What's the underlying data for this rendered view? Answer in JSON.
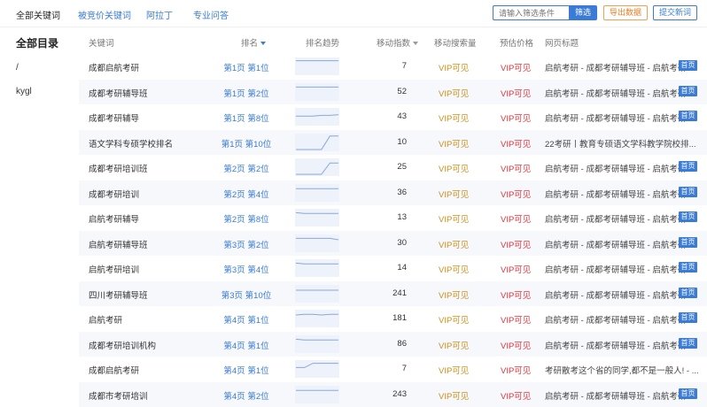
{
  "tabs": [
    "全部关键词",
    "被竞价关键词",
    "阿拉丁",
    "专业问答"
  ],
  "search": {
    "placeholder": "请输入筛选条件"
  },
  "buttons": {
    "filter": "筛选",
    "export": "导出数据",
    "submit": "提交新词"
  },
  "sidebar": {
    "title": "全部目录",
    "items": [
      "/",
      "kygl"
    ]
  },
  "columns": {
    "keyword": "关键词",
    "rank": "排名",
    "trend": "排名趋势",
    "index": "移动指数",
    "volume": "移动搜索量",
    "price": "预估价格",
    "page_title": "网页标题"
  },
  "badge_label": "首页",
  "rows": [
    {
      "keyword": "成都启航考研",
      "rank": "第1页 第1位",
      "trend": [
        2,
        2,
        2,
        2,
        2,
        2
      ],
      "index": "7",
      "volume": "VIP可见",
      "price": "VIP可见",
      "title": "启航考研 - 成都考研辅导班 - 启航考研",
      "badge": true
    },
    {
      "keyword": "成都考研辅导班",
      "rank": "第1页 第2位",
      "trend": [
        3,
        3,
        3,
        3,
        3,
        3
      ],
      "index": "52",
      "volume": "VIP可见",
      "price": "VIP可见",
      "title": "启航考研 - 成都考研辅导班 - 启航考研",
      "badge": true
    },
    {
      "keyword": "成都考研辅导",
      "rank": "第1页 第8位",
      "trend": [
        9,
        9,
        9,
        8,
        8,
        7
      ],
      "index": "43",
      "volume": "VIP可见",
      "price": "VIP可见",
      "title": "启航考研 - 成都考研辅导班 - 启航考研",
      "badge": true
    },
    {
      "keyword": "语文学科专硕学校排名",
      "rank": "第1页 第10位",
      "trend": [
        20,
        20,
        20,
        20,
        1,
        1
      ],
      "index": "10",
      "volume": "VIP可见",
      "price": "VIP可见",
      "title": "22考研丨教育专硕语文学科教学院校排...",
      "badge": false
    },
    {
      "keyword": "成都考研培训班",
      "rank": "第2页 第2位",
      "trend": [
        20,
        20,
        20,
        20,
        4,
        4
      ],
      "index": "25",
      "volume": "VIP可见",
      "price": "VIP可见",
      "title": "启航考研 - 成都考研辅导班 - 启航考研",
      "badge": true
    },
    {
      "keyword": "成都考研培训",
      "rank": "第2页 第4位",
      "trend": [
        4,
        4,
        4,
        4,
        4,
        4
      ],
      "index": "36",
      "volume": "VIP可见",
      "price": "VIP可见",
      "title": "启航考研 - 成都考研辅导班 - 启航考研",
      "badge": true
    },
    {
      "keyword": "启航考研辅导",
      "rank": "第2页 第8位",
      "trend": [
        3,
        4,
        4,
        4,
        4,
        4
      ],
      "index": "13",
      "volume": "VIP可见",
      "price": "VIP可见",
      "title": "启航考研 - 成都考研辅导班 - 启航考研",
      "badge": true
    },
    {
      "keyword": "启航考研辅导班",
      "rank": "第3页 第2位",
      "trend": [
        3,
        3,
        3,
        3,
        3,
        5
      ],
      "index": "30",
      "volume": "VIP可见",
      "price": "VIP可见",
      "title": "启航考研 - 成都考研辅导班 - 启航考研",
      "badge": true
    },
    {
      "keyword": "启航考研培训",
      "rank": "第3页 第4位",
      "trend": [
        3,
        4,
        4,
        4,
        4,
        4
      ],
      "index": "14",
      "volume": "VIP可见",
      "price": "VIP可见",
      "title": "启航考研 - 成都考研辅导班 - 启航考研",
      "badge": true
    },
    {
      "keyword": "四川考研辅导班",
      "rank": "第3页 第10位",
      "trend": [
        5,
        5,
        5,
        5,
        5,
        5
      ],
      "index": "241",
      "volume": "VIP可见",
      "price": "VIP可见",
      "title": "启航考研 - 成都考研辅导班 - 启航考研",
      "badge": true
    },
    {
      "keyword": "启航考研",
      "rank": "第4页 第1位",
      "trend": [
        5,
        4,
        4,
        5,
        4,
        4
      ],
      "index": "181",
      "volume": "VIP可见",
      "price": "VIP可见",
      "title": "启航考研 - 成都考研辅导班 - 启航考研",
      "badge": true
    },
    {
      "keyword": "成都考研培训机构",
      "rank": "第4页 第1位",
      "trend": [
        3,
        4,
        4,
        4,
        4,
        4
      ],
      "index": "86",
      "volume": "VIP可见",
      "price": "VIP可见",
      "title": "启航考研 - 成都考研辅导班 - 启航考研",
      "badge": true
    },
    {
      "keyword": "成都启航考研",
      "rank": "第4页 第1位",
      "trend": [
        8,
        8,
        2,
        2,
        2,
        2
      ],
      "index": "7",
      "volume": "VIP可见",
      "price": "VIP可见",
      "title": "考研散考这个省的同学,都不是一般人! - ...",
      "badge": false
    },
    {
      "keyword": "成都市考研培训",
      "rank": "第4页 第2位",
      "trend": [
        4,
        4,
        4,
        4,
        4,
        4
      ],
      "index": "243",
      "volume": "VIP可见",
      "price": "VIP可见",
      "title": "启航考研 - 成都考研辅导班 - 启航考研",
      "badge": true
    }
  ]
}
